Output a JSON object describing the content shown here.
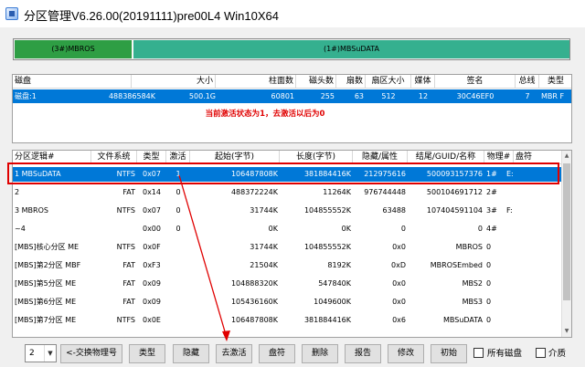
{
  "window": {
    "title": "分区管理V6.26.00(20191111)pre00L4 Win10X64"
  },
  "diskbar": {
    "seg1_label": "(3#)MBROS",
    "seg2_label": "(1#)MBSuDATA"
  },
  "disk_table": {
    "headers": [
      "磁盘",
      "大小",
      "柱面数",
      "磁头数",
      "扇数",
      "扇区大小",
      "媒体",
      "签名",
      "总线",
      "类型"
    ],
    "rows": [
      {
        "disk": "磁盘:1",
        "size_k": "488386584K",
        "size_g": "500.1G",
        "cylinders": "60801",
        "heads": "255",
        "sectors": "63",
        "sector_size": "512",
        "media": "12",
        "signature": "30C46EF0",
        "bus": "7",
        "type": "MBR F"
      }
    ]
  },
  "annotation": {
    "message": "当前激活状态为1，去激活以后为0"
  },
  "part_table": {
    "headers": [
      "分区逻辑#",
      "文件系统",
      "类型",
      "激活",
      "起始(字节)",
      "长度(字节)",
      "隐藏/属性",
      "结尾/GUID/名称",
      "物理#",
      "盘符"
    ],
    "rows": [
      {
        "name": "1 MBSuDATA",
        "fs": "NTFS",
        "type": "0x07",
        "active": "1",
        "start": "106487808K",
        "length": "381884416K",
        "hidden": "212975616",
        "end": "500093157376",
        "phys": "1#",
        "drive": "E:"
      },
      {
        "name": "2",
        "fs": "FAT",
        "type": "0x14",
        "active": "0",
        "start": "488372224K",
        "length": "11264K",
        "hidden": "976744448",
        "end": "500104691712",
        "phys": "2#",
        "drive": ""
      },
      {
        "name": "3 MBROS",
        "fs": "NTFS",
        "type": "0x07",
        "active": "0",
        "start": "31744K",
        "length": "104855552K",
        "hidden": "63488",
        "end": "107404591104",
        "phys": "3#",
        "drive": "F:"
      },
      {
        "name": "~4",
        "fs": "",
        "type": "0x00",
        "active": "0",
        "start": "0K",
        "length": "0K",
        "hidden": "0",
        "end": "0",
        "phys": "4#",
        "drive": ""
      },
      {
        "name": "[MBS]核心分区 ME",
        "fs": "NTFS",
        "type": "0x0F",
        "active": "",
        "start": "31744K",
        "length": "104855552K",
        "hidden": "0x0",
        "end": "MBROS",
        "phys": "0",
        "drive": ""
      },
      {
        "name": "[MBS]第2分区 MBF",
        "fs": "FAT",
        "type": "0xF3",
        "active": "",
        "start": "21504K",
        "length": "8192K",
        "hidden": "0xD",
        "end": "MBROSEmbed",
        "phys": "0",
        "drive": ""
      },
      {
        "name": "[MBS]第5分区 ME",
        "fs": "FAT",
        "type": "0x09",
        "active": "",
        "start": "104888320K",
        "length": "547840K",
        "hidden": "0x0",
        "end": "MBS2",
        "phys": "0",
        "drive": ""
      },
      {
        "name": "[MBS]第6分区 ME",
        "fs": "FAT",
        "type": "0x09",
        "active": "",
        "start": "105436160K",
        "length": "1049600K",
        "hidden": "0x0",
        "end": "MBS3",
        "phys": "0",
        "drive": ""
      },
      {
        "name": "[MBS]第7分区 ME",
        "fs": "NTFS",
        "type": "0x0E",
        "active": "",
        "start": "106487808K",
        "length": "381884416K",
        "hidden": "0x6",
        "end": "MBSuDATA",
        "phys": "0",
        "drive": ""
      }
    ]
  },
  "toolbar": {
    "combo_value": "2",
    "swap_label": "<-交换物理号",
    "type_label": "类型",
    "hide_label": "隐藏",
    "deactivate_label": "去激活",
    "drive_label": "盘符",
    "delete_label": "删除",
    "report_label": "报告",
    "modify_label": "修改",
    "init_label": "初始",
    "all_disks_label": "所有磁盘",
    "media_label": "介质"
  },
  "colors": {
    "accent": "#0078d7",
    "annotation": "#e00000",
    "seg1": "#2e9e44",
    "seg2": "#35b08f"
  }
}
